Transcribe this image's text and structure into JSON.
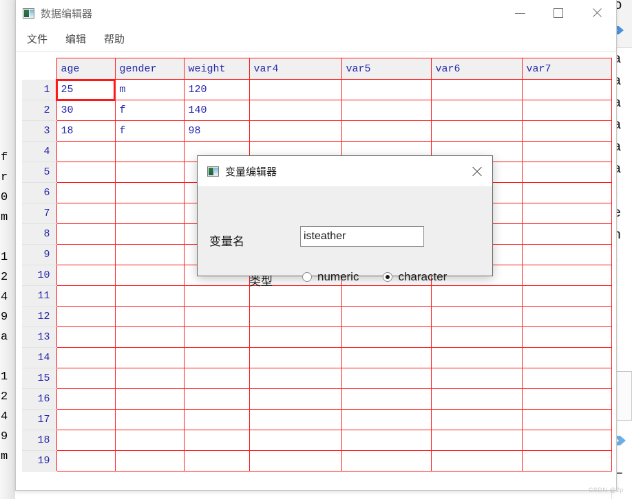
{
  "window": {
    "title": "数据编辑器",
    "icon": "app-icon",
    "buttons": {
      "minimize": "minimize-icon",
      "maximize": "maximize-icon",
      "close": "close-icon"
    }
  },
  "menu": {
    "items": [
      {
        "label": "文件"
      },
      {
        "label": "编辑"
      },
      {
        "label": "帮助"
      }
    ]
  },
  "grid": {
    "columns": [
      "age",
      "gender",
      "weight",
      "var4",
      "var5",
      "var6",
      "var7"
    ],
    "rows": [
      {
        "n": "1",
        "cells": [
          "25",
          "m",
          "120",
          "",
          "",
          "",
          ""
        ]
      },
      {
        "n": "2",
        "cells": [
          "30",
          "f",
          "140",
          "",
          "",
          "",
          ""
        ]
      },
      {
        "n": "3",
        "cells": [
          "18",
          "f",
          "98",
          "",
          "",
          "",
          ""
        ]
      },
      {
        "n": "4",
        "cells": [
          "",
          "",
          "",
          "",
          "",
          "",
          ""
        ]
      },
      {
        "n": "5",
        "cells": [
          "",
          "",
          "",
          "",
          "",
          "",
          ""
        ]
      },
      {
        "n": "6",
        "cells": [
          "",
          "",
          "",
          "",
          "",
          "",
          ""
        ]
      },
      {
        "n": "7",
        "cells": [
          "",
          "",
          "",
          "",
          "",
          "",
          ""
        ]
      },
      {
        "n": "8",
        "cells": [
          "",
          "",
          "",
          "",
          "",
          "",
          ""
        ]
      },
      {
        "n": "9",
        "cells": [
          "",
          "",
          "",
          "",
          "",
          "",
          ""
        ]
      },
      {
        "n": "10",
        "cells": [
          "",
          "",
          "",
          "",
          "",
          "",
          ""
        ]
      },
      {
        "n": "11",
        "cells": [
          "",
          "",
          "",
          "",
          "",
          "",
          ""
        ]
      },
      {
        "n": "12",
        "cells": [
          "",
          "",
          "",
          "",
          "",
          "",
          ""
        ]
      },
      {
        "n": "13",
        "cells": [
          "",
          "",
          "",
          "",
          "",
          "",
          ""
        ]
      },
      {
        "n": "14",
        "cells": [
          "",
          "",
          "",
          "",
          "",
          "",
          ""
        ]
      },
      {
        "n": "15",
        "cells": [
          "",
          "",
          "",
          "",
          "",
          "",
          ""
        ]
      },
      {
        "n": "16",
        "cells": [
          "",
          "",
          "",
          "",
          "",
          "",
          ""
        ]
      },
      {
        "n": "17",
        "cells": [
          "",
          "",
          "",
          "",
          "",
          "",
          ""
        ]
      },
      {
        "n": "18",
        "cells": [
          "",
          "",
          "",
          "",
          "",
          "",
          ""
        ]
      },
      {
        "n": "19",
        "cells": [
          "",
          "",
          "",
          "",
          "",
          "",
          ""
        ]
      }
    ],
    "selected_cell": {
      "row": 0,
      "col": 0
    },
    "grid_line_color": "#ff1717",
    "text_color": "#2626aa",
    "header_bg": "#f0f0f0"
  },
  "dialog": {
    "title": "变量编辑器",
    "icon": "app-icon",
    "close_icon": "close-icon",
    "name_label": "变量名",
    "name_value": "isteather",
    "name_placeholder": "",
    "type_label": "类型",
    "options": [
      {
        "label": "numeric",
        "selected": false
      },
      {
        "label": "character",
        "selected": true
      }
    ]
  },
  "background": {
    "left_strip": "f\nr\n0\nm\n\n1\n2\n4\n9\na\n\n1\n2\n4\n9\nm",
    "right_strip": "a\na\na\na\na\na\nt\ne\nh\nt\nt\nt\nt\nt",
    "right_top_glyph": "o"
  },
  "watermark": "CSDN @2p"
}
